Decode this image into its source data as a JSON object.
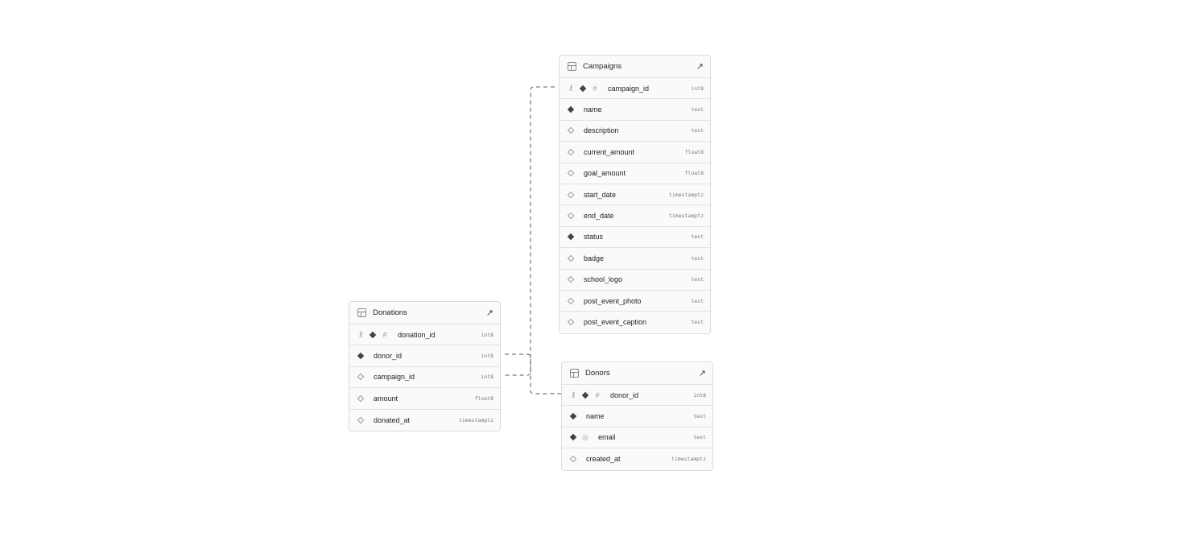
{
  "tables": [
    {
      "id": "campaigns",
      "name": "Campaigns",
      "columns": [
        {
          "name": "campaign_id",
          "type": "int8",
          "pk": true,
          "required": true,
          "identity": true
        },
        {
          "name": "name",
          "type": "text",
          "required": true
        },
        {
          "name": "description",
          "type": "text",
          "required": false
        },
        {
          "name": "current_amount",
          "type": "float8",
          "required": false
        },
        {
          "name": "goal_amount",
          "type": "float8",
          "required": false
        },
        {
          "name": "start_date",
          "type": "timestamptz",
          "required": false
        },
        {
          "name": "end_date",
          "type": "timestamptz",
          "required": false
        },
        {
          "name": "status",
          "type": "text",
          "required": true
        },
        {
          "name": "badge",
          "type": "text",
          "required": false
        },
        {
          "name": "school_logo",
          "type": "text",
          "required": false
        },
        {
          "name": "post_event_photo",
          "type": "text",
          "required": false
        },
        {
          "name": "post_event_caption",
          "type": "text",
          "required": false
        }
      ]
    },
    {
      "id": "donations",
      "name": "Donations",
      "columns": [
        {
          "name": "donation_id",
          "type": "int8",
          "pk": true,
          "required": true,
          "identity": true
        },
        {
          "name": "donor_id",
          "type": "int8",
          "required": true
        },
        {
          "name": "campaign_id",
          "type": "int8",
          "required": false
        },
        {
          "name": "amount",
          "type": "float8",
          "required": false
        },
        {
          "name": "donated_at",
          "type": "timestamptz",
          "required": false
        }
      ]
    },
    {
      "id": "donors",
      "name": "Donors",
      "columns": [
        {
          "name": "donor_id",
          "type": "int8",
          "pk": true,
          "required": true,
          "identity": true
        },
        {
          "name": "name",
          "type": "text",
          "required": true
        },
        {
          "name": "email",
          "type": "text",
          "required": true,
          "unique": true
        },
        {
          "name": "created_at",
          "type": "timestamptz",
          "required": false
        }
      ]
    }
  ]
}
